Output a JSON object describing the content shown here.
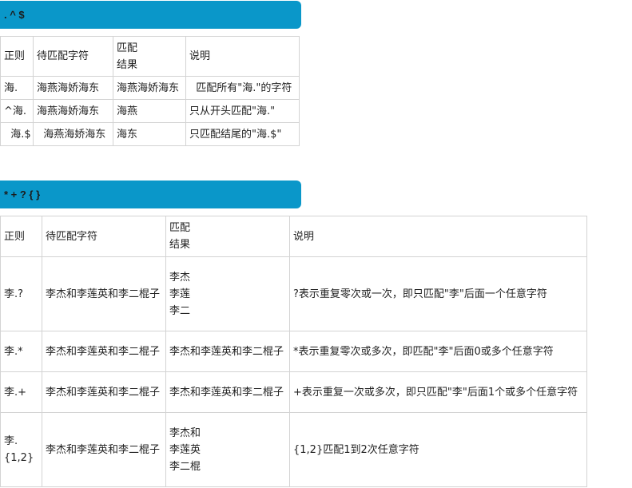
{
  "section1": {
    "title": ". ^ $",
    "headers": [
      "正则",
      "待匹配字符",
      "匹配\n结果",
      "说明"
    ],
    "rows": [
      [
        "海.",
        "海燕海娇海东",
        "海燕海娇海东",
        "  匹配所有\"海.\"的字符"
      ],
      [
        "^海.",
        "海燕海娇海东",
        "海燕",
        "只从开头匹配\"海.\""
      ],
      [
        "  海.$",
        "  海燕海娇海东",
        "海东",
        "只匹配结尾的\"海.$\""
      ]
    ]
  },
  "section2": {
    "title": "* + ? { }",
    "headers": [
      "正则",
      "待匹配字符",
      "匹配\n结果",
      "说明"
    ],
    "rows": [
      [
        "李.?",
        "李杰和李莲英和李二棍子",
        "李杰\n李莲\n李二",
        "?表示重复零次或一次，即只匹配\"李\"后面一个任意字符"
      ],
      [
        "李.*",
        "李杰和李莲英和李二棍子",
        "李杰和李莲英和李二棍子",
        "*表示重复零次或多次，即匹配\"李\"后面0或多个任意字符"
      ],
      [
        "李.+",
        "李杰和李莲英和李二棍子",
        "李杰和李莲英和李二棍子",
        "+表示重复一次或多次，即只匹配\"李\"后面1个或多个任意字符"
      ],
      [
        "李.\n{1,2}",
        "李杰和李莲英和李二棍子",
        "李杰和\n李莲英\n李二棍",
        "{1,2}匹配1到2次任意字符"
      ]
    ]
  }
}
